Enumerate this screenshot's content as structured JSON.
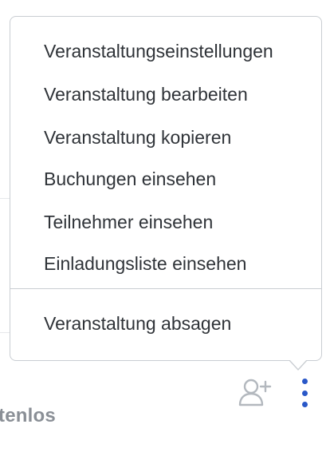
{
  "menu": {
    "items": [
      {
        "label": "Veranstaltungseinstellungen"
      },
      {
        "label": "Veranstaltung bearbeiten"
      },
      {
        "label": "Veranstaltung kopieren"
      },
      {
        "label": "Buchungen einsehen"
      },
      {
        "label": "Teilnehmer einsehen"
      },
      {
        "label": "Einladungsliste einsehen"
      }
    ],
    "danger_item": {
      "label": "Veranstaltung absagen"
    }
  },
  "background": {
    "partial_text": "tenlos"
  },
  "actions": {
    "add_participant_icon": "add-user-icon",
    "more_icon": "kebab-menu-icon"
  },
  "colors": {
    "text": "#2f3338",
    "border": "#c9cdd2",
    "accent": "#2a58c8",
    "muted": "#8a8f96"
  }
}
